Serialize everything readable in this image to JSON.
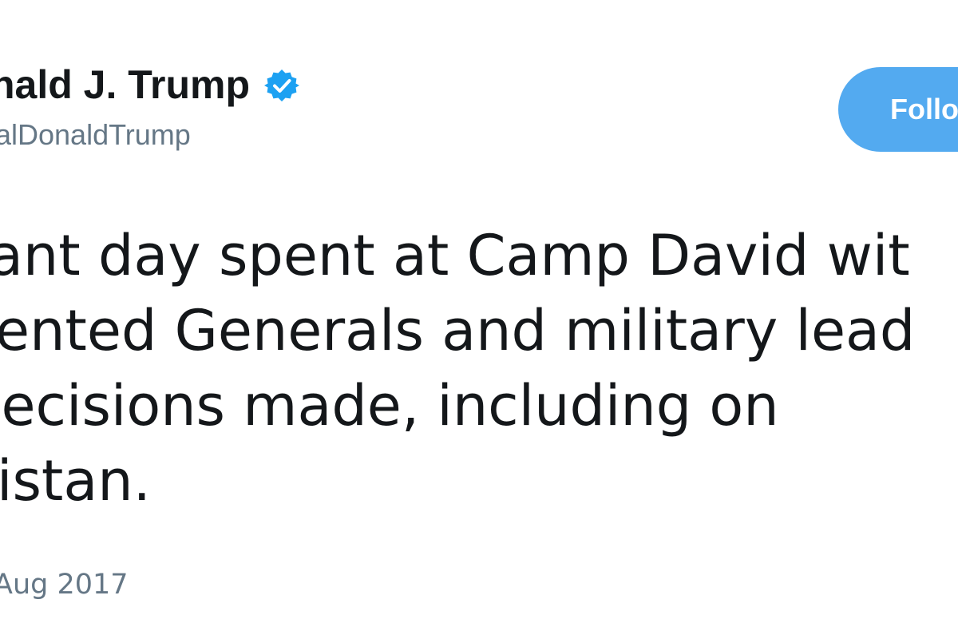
{
  "tweet": {
    "display_name": "nald J. Trump",
    "handle": "alDonaldTrump",
    "follow_label": "Follo",
    "text_lines": [
      "ant day spent at Camp David wit",
      "ented Generals and military lead",
      "lecisions made, including on",
      "istan."
    ],
    "timestamp": "Aug 2017",
    "verified_icon": "verified-badge-icon"
  },
  "colors": {
    "name": "#14171a",
    "handle": "#657786",
    "follow_button": "#53aaf0",
    "verified": "#1da1f2"
  }
}
